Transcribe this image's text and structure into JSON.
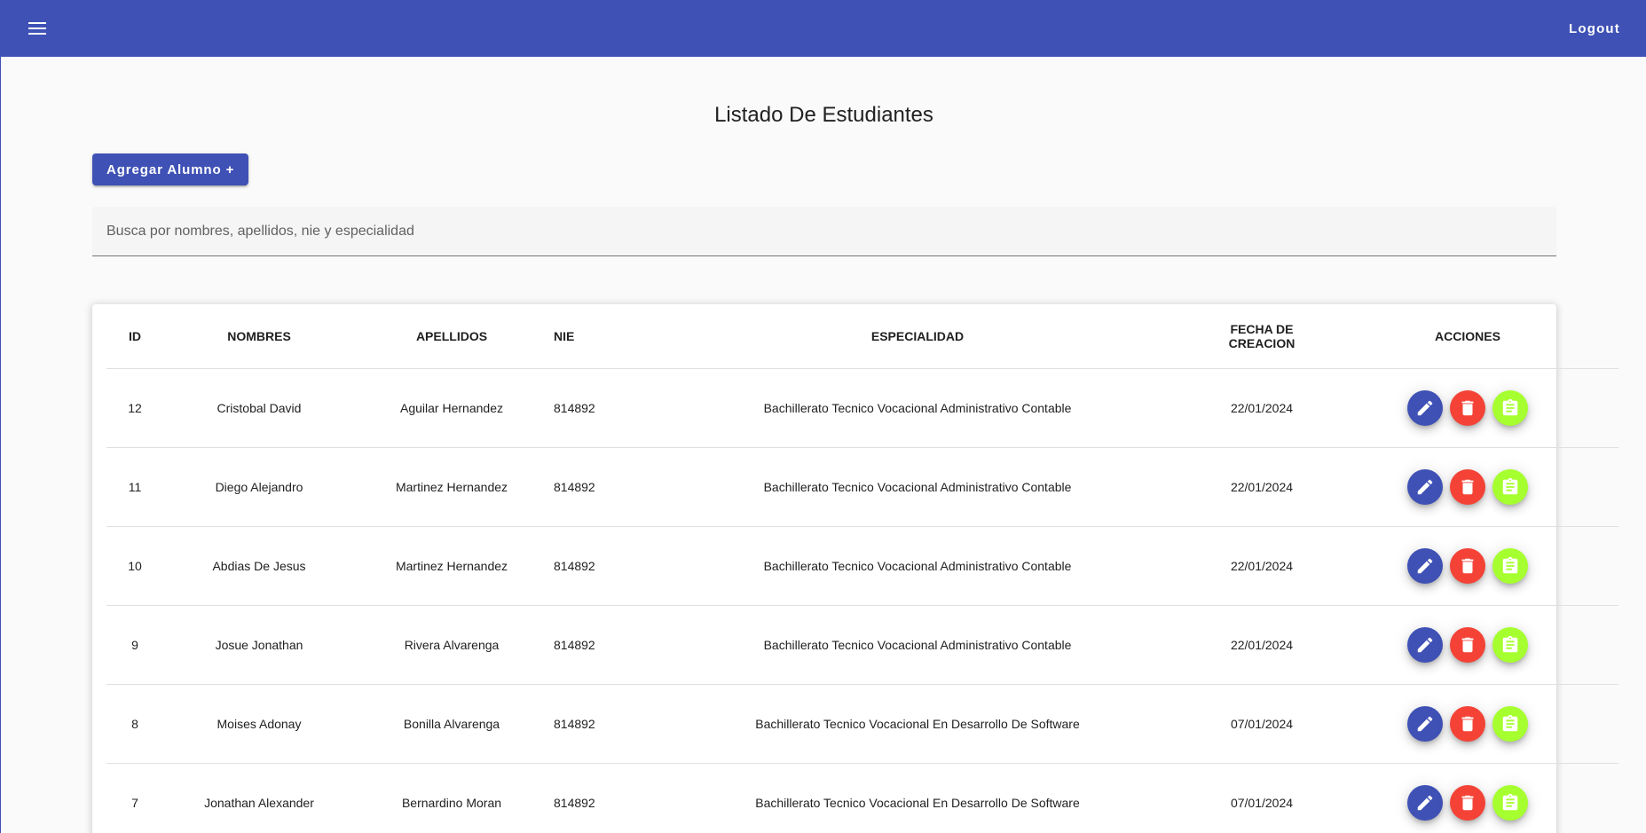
{
  "toolbar": {
    "menu_icon": "menu-icon",
    "logout_label": "Logout",
    "color": "#3f51b5"
  },
  "main": {
    "title": "Listado De Estudiantes",
    "add_button_label": "Agregar Alumno +",
    "search_placeholder": "Busca por nombres, apellidos, nie y especialidad",
    "search_value": ""
  },
  "table": {
    "headers": {
      "id": "ID",
      "nombres": "NOMBRES",
      "apellidos": "APELLIDOS",
      "nie": "NIE",
      "especialidad": "ESPECIALIDAD",
      "fecha": "FECHA DE CREACION",
      "acciones": "ACCIONES"
    },
    "rows": [
      {
        "id": "12",
        "nombres": "Cristobal David",
        "apellidos": "Aguilar Hernandez",
        "nie": "814892",
        "especialidad": "Bachillerato Tecnico Vocacional Administrativo Contable",
        "fecha": "22/01/2024"
      },
      {
        "id": "11",
        "nombres": "Diego Alejandro",
        "apellidos": "Martinez Hernandez",
        "nie": "814892",
        "especialidad": "Bachillerato Tecnico Vocacional Administrativo Contable",
        "fecha": "22/01/2024"
      },
      {
        "id": "10",
        "nombres": "Abdias De Jesus",
        "apellidos": "Martinez Hernandez",
        "nie": "814892",
        "especialidad": "Bachillerato Tecnico Vocacional Administrativo Contable",
        "fecha": "22/01/2024"
      },
      {
        "id": "9",
        "nombres": "Josue Jonathan",
        "apellidos": "Rivera Alvarenga",
        "nie": "814892",
        "especialidad": "Bachillerato Tecnico Vocacional Administrativo Contable",
        "fecha": "22/01/2024"
      },
      {
        "id": "8",
        "nombres": "Moises Adonay",
        "apellidos": "Bonilla Alvarenga",
        "nie": "814892",
        "especialidad": "Bachillerato Tecnico Vocacional En Desarrollo De Software",
        "fecha": "07/01/2024"
      },
      {
        "id": "7",
        "nombres": "Jonathan Alexander",
        "apellidos": "Bernardino Moran",
        "nie": "814892",
        "especialidad": "Bachillerato Tecnico Vocacional En Desarrollo De Software",
        "fecha": "07/01/2024"
      }
    ],
    "action_icons": [
      "edit-icon",
      "delete-icon",
      "report-icon"
    ],
    "action_colors": {
      "edit": "#3f51b5",
      "delete": "#f44336",
      "report": "#a6ff2e"
    }
  }
}
